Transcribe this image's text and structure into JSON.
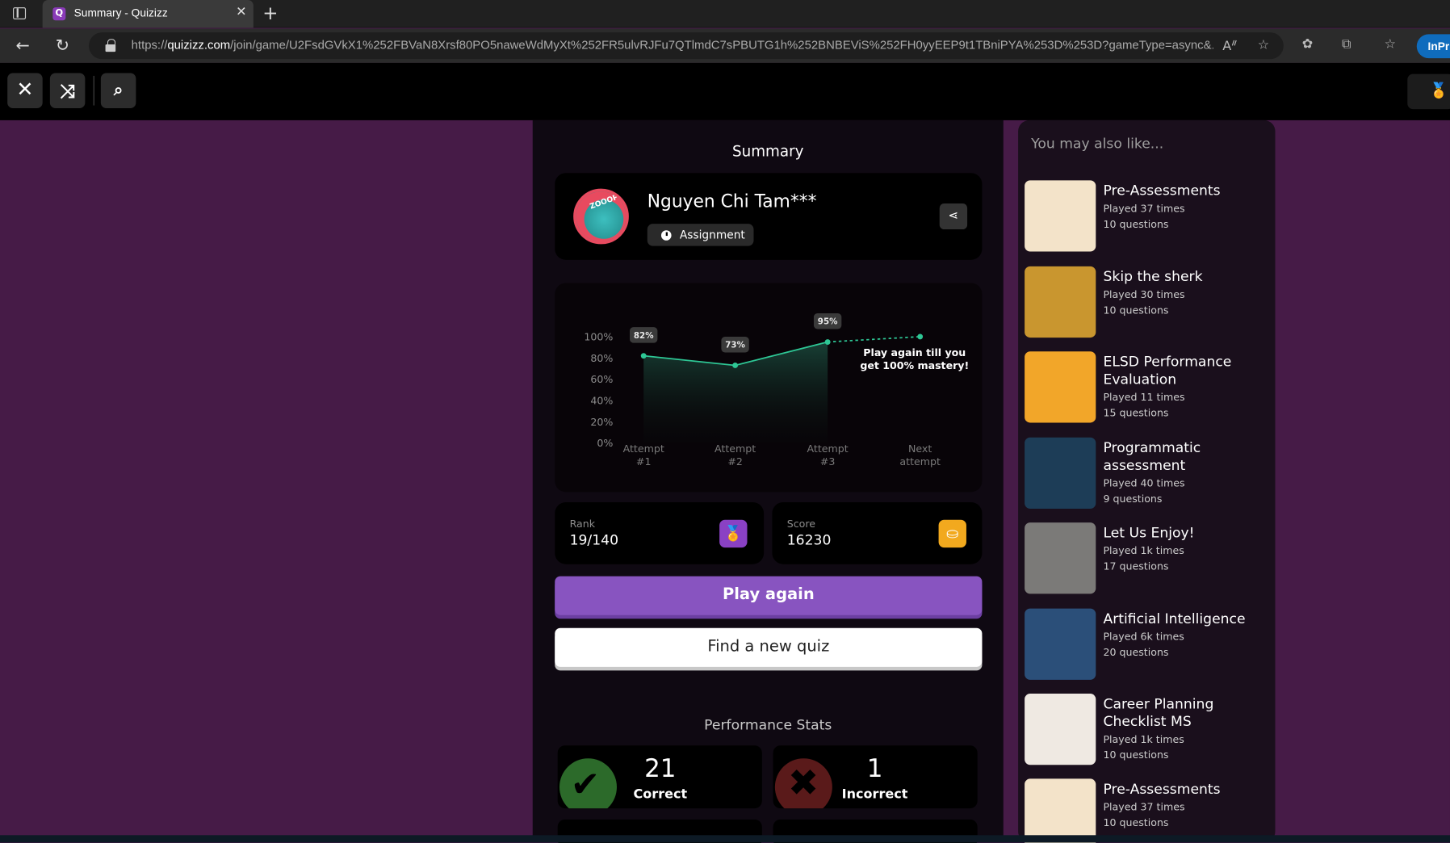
{
  "browser": {
    "tab_title": "Summary - Quizizz",
    "url_prefix": "https://",
    "url_domain": "quizizz.com",
    "url_path": "/join/game/U2FsdGVkX1%252FBVaN8Xrsf80PO5naweWdMyXt%252FR5ulvRJFu7QTlmdC7sPBUTG1h%252BNBEViS%252FH0yyEEP9t1TBniPYA%253D%253D?gameType=async&...",
    "inprivate_label": "InPri"
  },
  "profile": {
    "name": "Nguyen Chi Tam***",
    "assignment_label": "Assignment",
    "avatar_text": "ZOOOP!"
  },
  "page": {
    "title": "Summary"
  },
  "chart_data": {
    "type": "line",
    "categories": [
      "Attempt #1",
      "Attempt #2",
      "Attempt #3",
      "Next attempt"
    ],
    "values": [
      82,
      73,
      95,
      null
    ],
    "data_labels": [
      "82%",
      "73%",
      "95%"
    ],
    "projected": [
      95,
      100
    ],
    "yticks": [
      "100%",
      "80%",
      "60%",
      "40%",
      "20%",
      "0%"
    ],
    "ylim": [
      0,
      100
    ],
    "annotation_line1": "Play again till you",
    "annotation_line2": "get 100% mastery!",
    "color": "#2ec795"
  },
  "stats": {
    "rank_label": "Rank",
    "rank_value": "19/140",
    "score_label": "Score",
    "score_value": "16230",
    "correct_value": "21",
    "correct_label": "Correct",
    "incorrect_value": "1",
    "incorrect_label": "Incorrect"
  },
  "buttons": {
    "play_again": "Play again",
    "find_quiz": "Find a new quiz"
  },
  "perf_title": "Performance Stats",
  "side": {
    "title": "You may also like...",
    "items": [
      {
        "title": "Pre-Assessments",
        "played": "Played 37 times",
        "questions": "10 questions",
        "color": "#f3e3c9"
      },
      {
        "title": "Skip the sherk",
        "played": "Played 30 times",
        "questions": "10 questions",
        "color": "#c9962f"
      },
      {
        "title": "ELSD Performance Evaluation",
        "played": "Played 11 times",
        "questions": "15 questions",
        "color": "#f2a629"
      },
      {
        "title": "Programmatic assessment",
        "played": "Played 40 times",
        "questions": "9 questions",
        "color": "#1d3d57"
      },
      {
        "title": "Let Us Enjoy!",
        "played": "Played 1k times",
        "questions": "17 questions",
        "color": "#7b7a78"
      },
      {
        "title": "Artificial Intelligence",
        "played": "Played 6k times",
        "questions": "20 questions",
        "color": "#2b4f79"
      },
      {
        "title": "Career Planning Checklist MS",
        "played": "Played 1k times",
        "questions": "10 questions",
        "color": "#efe9e2"
      },
      {
        "title": "Pre-Assessments",
        "played": "Played 37 times",
        "questions": "10 questions",
        "color": "#f3e3c9"
      }
    ]
  }
}
